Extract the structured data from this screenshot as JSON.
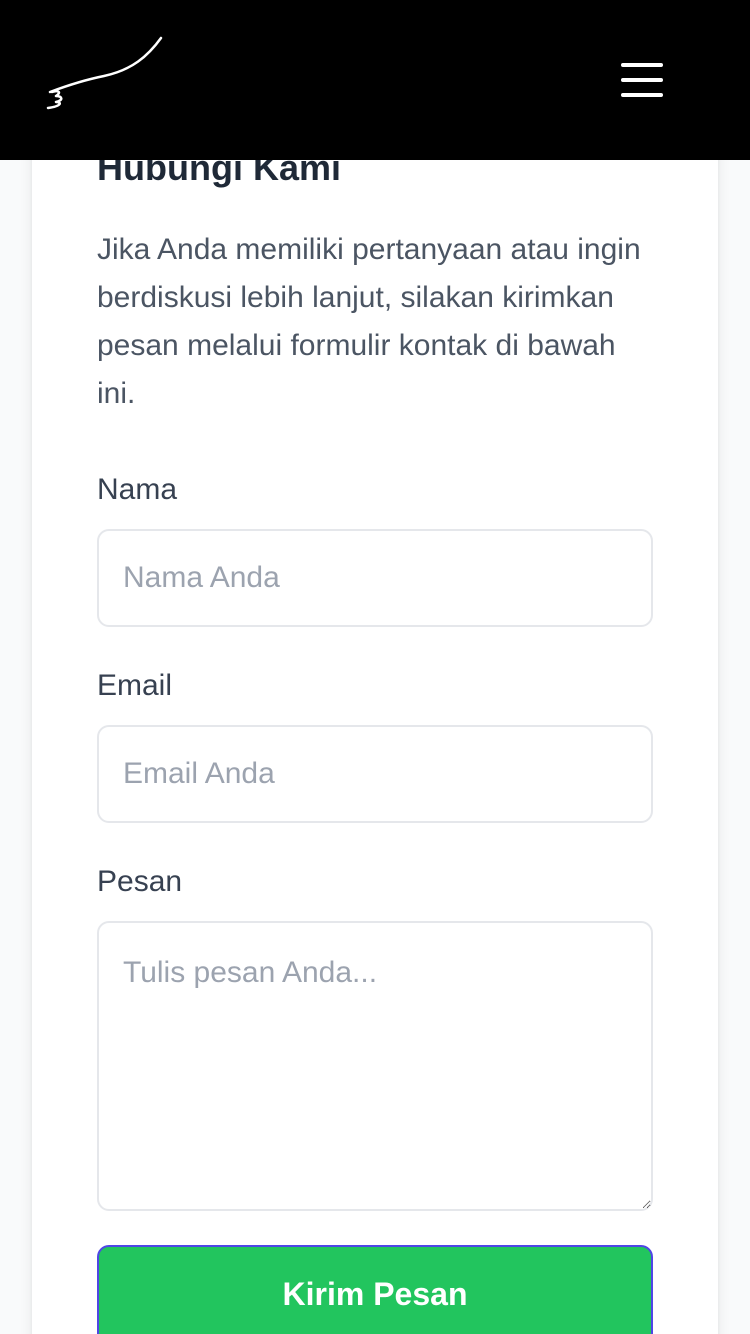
{
  "header": {
    "logo_icon": "signature-logo-icon",
    "menu_icon": "hamburger-menu-icon",
    "background": "#000000"
  },
  "contact": {
    "title": "Hubungi Kami",
    "intro": "Jika Anda memiliki pertanyaan atau ingin berdiskusi lebih lanjut, silakan kirimkan pesan melalui formulir kontak di bawah ini.",
    "fields": {
      "name": {
        "label": "Nama",
        "placeholder": "Nama Anda",
        "value": ""
      },
      "email": {
        "label": "Email",
        "placeholder": "Email Anda",
        "value": ""
      },
      "message": {
        "label": "Pesan",
        "placeholder": "Tulis pesan Anda...",
        "value": ""
      }
    },
    "submit_label": "Kirim Pesan"
  },
  "colors": {
    "accent_button": "#22c55e",
    "button_border": "#4f46e5",
    "text_primary": "#1f2937",
    "text_muted": "#4b5563",
    "placeholder": "#9ca3af"
  }
}
